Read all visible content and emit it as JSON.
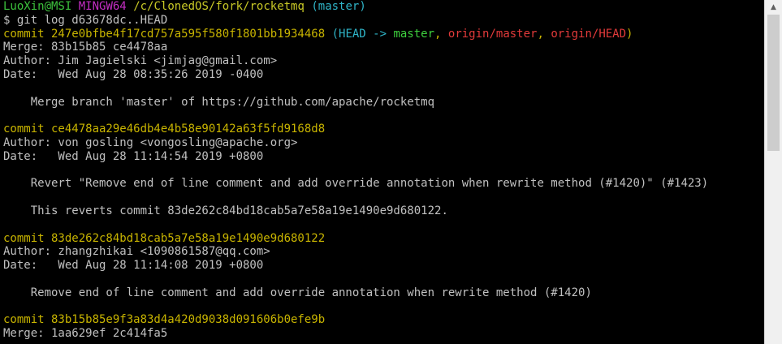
{
  "prompt": {
    "user_host": "LuoXin@MSI",
    "shell": "MINGW64",
    "path": "/c/ClonedOS/fork/rocketmq",
    "branch": "(master)"
  },
  "command": "$ git log d63678dc..HEAD",
  "commit1": {
    "label": "commit 247e0bfbe4f17cd757a595f580f1801bb1934468",
    "ref_open": "(HEAD -> ",
    "ref_master": "master",
    "sep1": ", ",
    "ref_origin_master": "origin/master",
    "sep2": ", ",
    "ref_origin_head": "origin/HEAD",
    "ref_close": ")",
    "merge": "Merge: 83b15b85 ce4478aa",
    "author": "Author: Jim Jagielski <jimjag@gmail.com>",
    "date": "Date:   Wed Aug 28 08:35:26 2019 -0400",
    "message": "    Merge branch 'master' of https://github.com/apache/rocketmq"
  },
  "commit2": {
    "label": "commit ce4478aa29e46db4e4b58e90142a63f5fd9168d8",
    "author": "Author: von gosling <vongosling@apache.org>",
    "date": "Date:   Wed Aug 28 11:14:54 2019 +0800",
    "message1": "    Revert \"Remove end of line comment and add override annotation when rewrite method (#1420)\" (#1423)",
    "message2": "    This reverts commit 83de262c84bd18cab5a7e58a19e1490e9d680122."
  },
  "commit3": {
    "label": "commit 83de262c84bd18cab5a7e58a19e1490e9d680122",
    "author": "Author: zhangzhikai <1090861587@qq.com>",
    "date": "Date:   Wed Aug 28 11:14:08 2019 +0800",
    "message": "    Remove end of line comment and add override annotation when rewrite method (#1420)"
  },
  "commit4": {
    "label": "commit 83b15b85e9f3a83d4a420d9038d091606b0efe9b",
    "merge": "Merge: 1aa629ef 2c414fa5"
  },
  "scrollbar": {
    "up_arrow": "▲",
    "position_fraction": 0.0,
    "visible_fraction": 0.4
  }
}
